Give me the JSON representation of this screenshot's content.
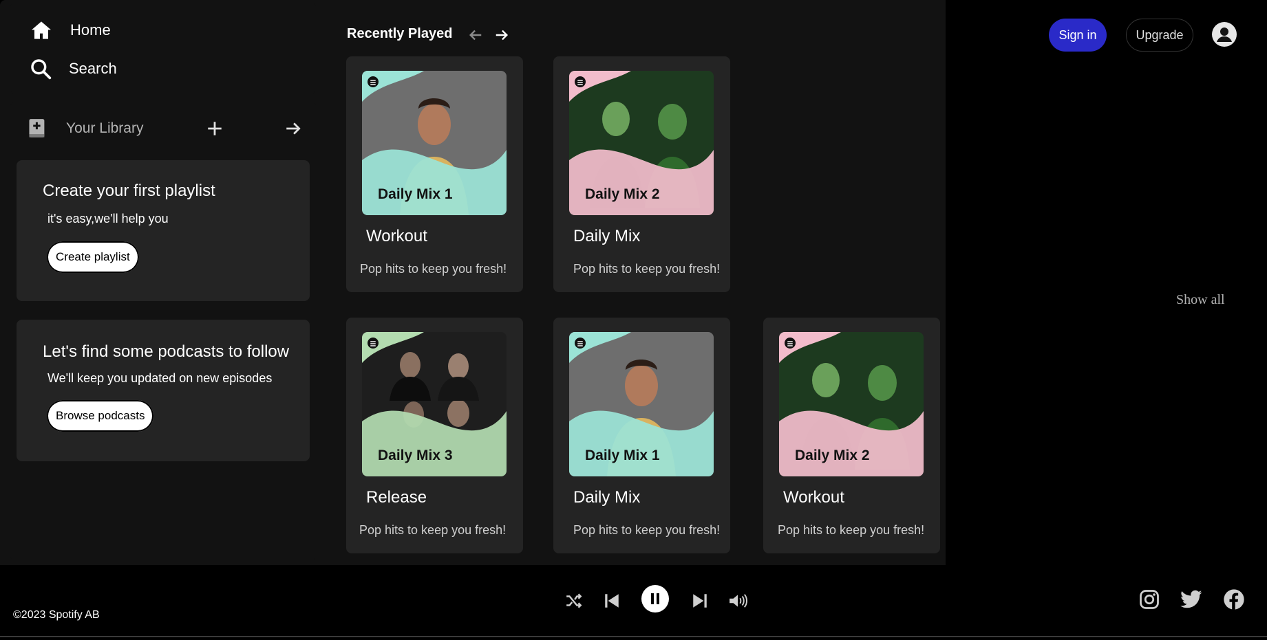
{
  "nav": {
    "home_label": "Home",
    "search_label": "Search"
  },
  "library": {
    "title": "Your Library",
    "playlist_card": {
      "title": "Create your first playlist",
      "subtitle": "it's easy,we'll help you",
      "button": "Create playlist"
    },
    "podcast_card": {
      "title": "Let's find some podcasts to follow",
      "subtitle": "We'll keep you updated on new episodes",
      "button": "Browse podcasts"
    }
  },
  "header": {
    "section_title": "Recently Played",
    "sign_in": "Sign in",
    "upgrade": "Upgrade",
    "show_all": "Show all"
  },
  "cards": [
    {
      "cover_label": "Daily Mix 1",
      "name": "Workout",
      "description": "Pop hits to keep you fresh!",
      "theme": "teal"
    },
    {
      "cover_label": "Daily Mix 2",
      "name": "Daily Mix",
      "description": "Pop hits to keep you fresh!",
      "theme": "pink"
    },
    {
      "cover_label": "Daily Mix 3",
      "name": "Release",
      "description": "Pop hits to keep you fresh!",
      "theme": "green"
    },
    {
      "cover_label": "Daily Mix 1",
      "name": "Daily Mix",
      "description": "Pop hits to keep you fresh!",
      "theme": "teal"
    },
    {
      "cover_label": "Daily Mix 2",
      "name": "Workout",
      "description": "Pop hits to keep you fresh!",
      "theme": "pink"
    }
  ],
  "footer": {
    "copyright": "©2023 Spotify AB"
  },
  "colors": {
    "background": "#000000",
    "panel": "#121212",
    "card": "#242424",
    "sign_in": "#2a2ac8",
    "teal": "#9be3d6",
    "pink": "#f2bccb",
    "green": "#b3dcb0"
  },
  "icons": [
    "home-icon",
    "search-icon",
    "library-icon",
    "plus-icon",
    "arrow-right-icon",
    "arrow-left-icon",
    "profile-icon",
    "shuffle-icon",
    "previous-icon",
    "pause-icon",
    "next-icon",
    "volume-icon",
    "instagram-icon",
    "twitter-icon",
    "facebook-icon",
    "spotify-logo-icon"
  ]
}
